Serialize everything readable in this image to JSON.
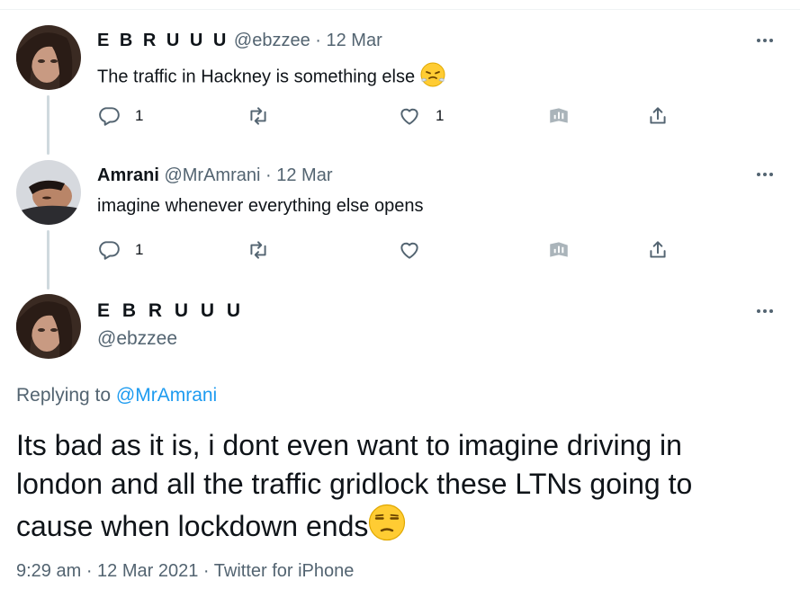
{
  "thread": [
    {
      "name": "E B R U U U",
      "handle": "@ebzzee",
      "sep": " · ",
      "date": "12 Mar",
      "text": "The traffic in Hackney is something else",
      "emoji": "steam-face",
      "replies": "1",
      "retweets": "",
      "likes": "1"
    },
    {
      "name": "Amrani",
      "handle": "@MrAmrani",
      "sep": " · ",
      "date": "12 Mar",
      "text": "imagine whenever everything else opens",
      "replies": "1",
      "retweets": "",
      "likes": ""
    }
  ],
  "main": {
    "name": "E B R U U U",
    "handle": "@ebzzee",
    "replying_prefix": "Replying to ",
    "replying_to": "@MrAmrani",
    "text_line1": "Its bad as it is, i dont even want to imagine driving in",
    "text_line2": "london and all the traffic gridlock these LTNs going to",
    "text_line3": "cause when lockdown ends",
    "emoji": "unamused-face",
    "time": "9:29 am",
    "dot": " · ",
    "date": "12 Mar 2021",
    "source": "Twitter for iPhone"
  },
  "colors": {
    "text": "#0f1419",
    "secondary": "#536471",
    "link": "#1d9bf0",
    "thread_line": "#cfd9de",
    "emoji_yellow": "#ffcc33"
  },
  "icons": [
    "reply-icon",
    "retweet-icon",
    "like-icon",
    "analytics-icon",
    "share-icon",
    "more-icon"
  ]
}
